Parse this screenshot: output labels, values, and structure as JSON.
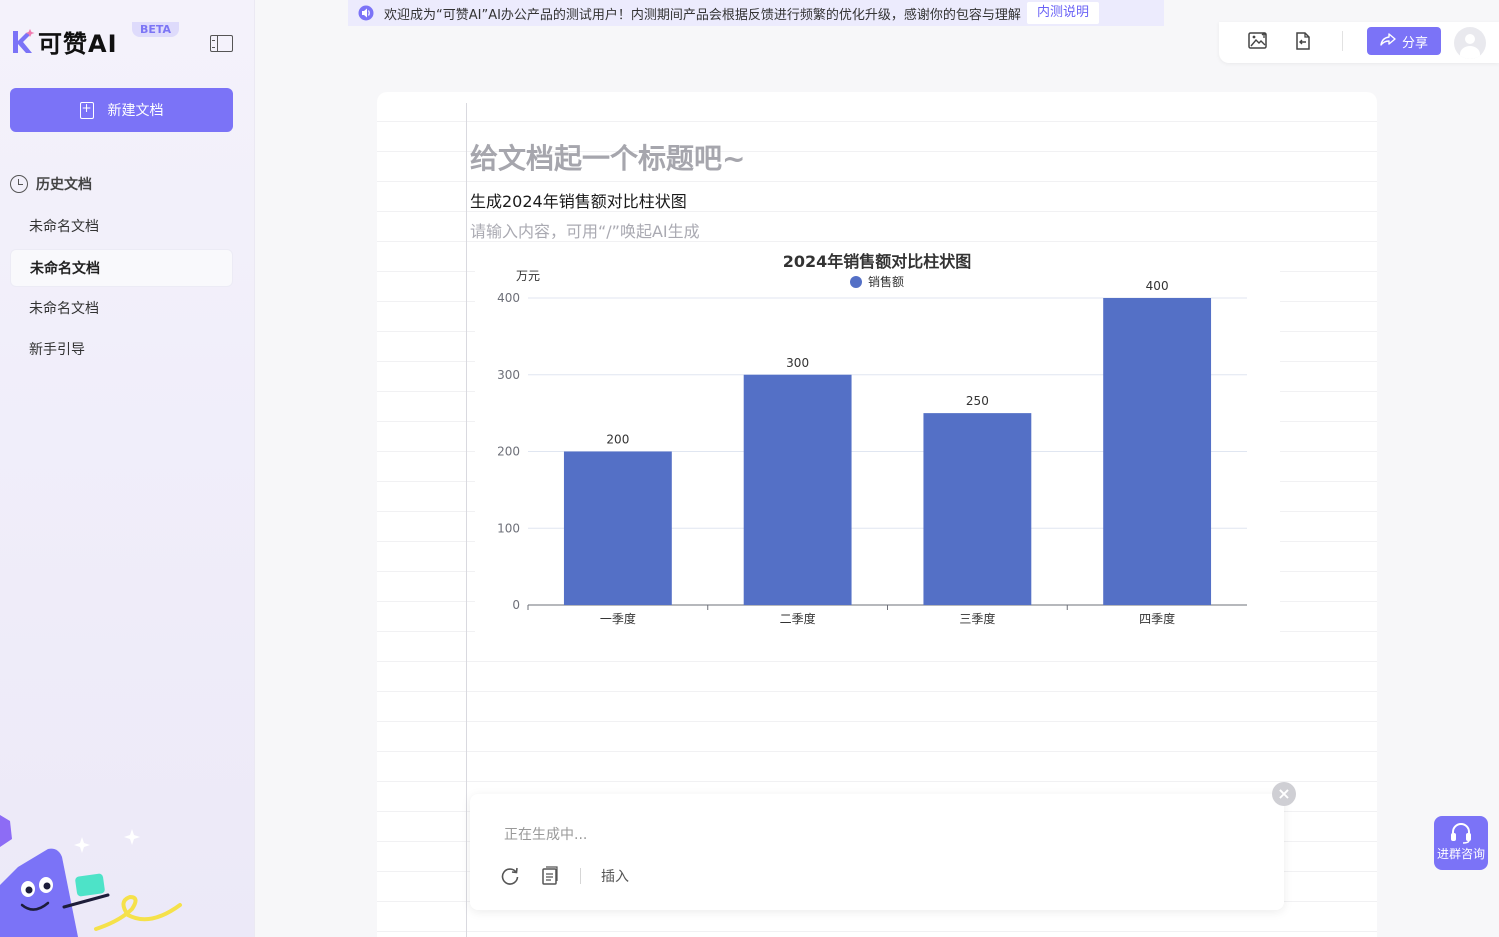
{
  "announcement": {
    "text": "欢迎成为“可赞AI”AI办公产品的测试用户！内测期间产品会根据反馈进行频繁的优化升级，感谢你的包容与理解",
    "link": "内测说明"
  },
  "sidebar": {
    "logo_text": "可赞AI",
    "beta": "BETA",
    "new_doc_label": "新建文档",
    "history_title": "历史文档",
    "items": [
      {
        "label": "未命名文档",
        "active": false
      },
      {
        "label": "未命名文档",
        "active": true
      },
      {
        "label": "未命名文档",
        "active": false
      },
      {
        "label": "新手引导",
        "active": false
      }
    ]
  },
  "toolbar": {
    "image_icon": "image-up-icon",
    "export_icon": "file-export-icon",
    "share_label": "分享",
    "avatar_icon": "user-avatar-icon"
  },
  "document": {
    "title_placeholder": "给文档起一个标题吧~",
    "line1": "生成2024年销售额对比柱状图",
    "content_placeholder": "请输入内容，可用“/”唤起AI生成"
  },
  "chart_data": {
    "type": "bar",
    "title": "2024年销售额对比柱状图",
    "ylabel": "万元",
    "xlabel": "",
    "categories": [
      "一季度",
      "二季度",
      "三季度",
      "四季度"
    ],
    "series": [
      {
        "name": "销售额",
        "values": [
          200,
          300,
          250,
          400
        ]
      }
    ],
    "ylim": [
      0,
      400
    ],
    "yticks": [
      0,
      100,
      200,
      300,
      400
    ],
    "grid": true,
    "legend": "top-center",
    "bar_color": "#5470c6"
  },
  "generation": {
    "status": "正在生成中...",
    "insert_label": "插入",
    "close": "×"
  },
  "consult": {
    "label": "进群咨询"
  },
  "colors": {
    "accent": "#7b73f7",
    "bar": "#5470c6"
  }
}
